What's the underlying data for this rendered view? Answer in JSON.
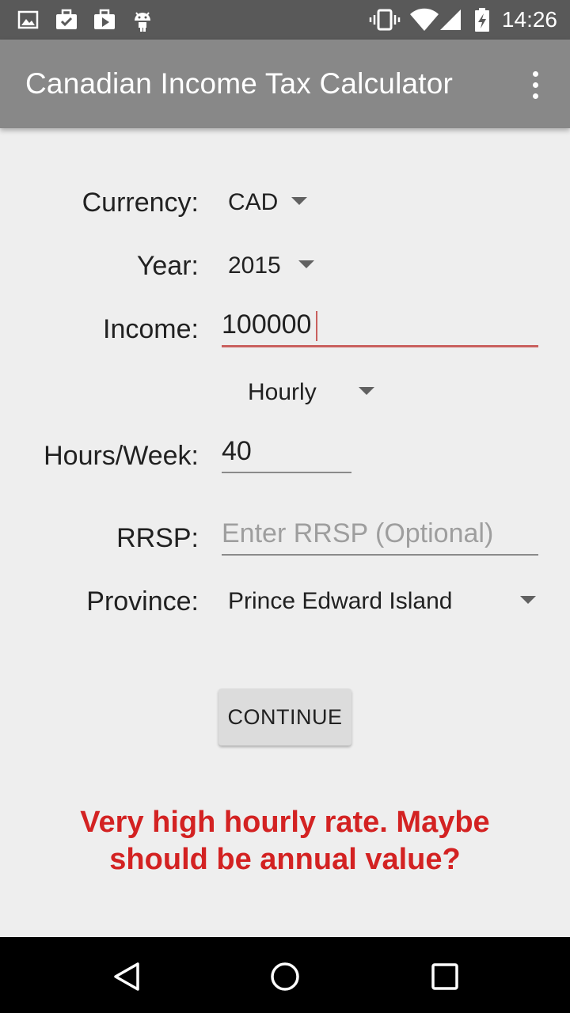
{
  "status_bar": {
    "time": "14:26",
    "icons": [
      "gallery-icon",
      "briefcase-check-icon",
      "play-store-icon",
      "android-icon",
      "vibrate-icon",
      "wifi-icon",
      "signal-icon",
      "battery-charging-icon"
    ]
  },
  "app_bar": {
    "title": "Canadian Income Tax Calculator",
    "menu_icon": "overflow-menu-icon"
  },
  "form": {
    "currency": {
      "label": "Currency:",
      "value": "CAD"
    },
    "year": {
      "label": "Year:",
      "value": "2015"
    },
    "income": {
      "label": "Income:",
      "value": "100000"
    },
    "period": {
      "value": "Hourly"
    },
    "hours": {
      "label": "Hours/Week:",
      "value": "40"
    },
    "rrsp": {
      "label": "RRSP:",
      "value": "",
      "placeholder": "Enter RRSP (Optional)"
    },
    "province": {
      "label": "Province:",
      "value": "Prince Edward Island"
    }
  },
  "actions": {
    "continue_label": "CONTINUE"
  },
  "warning": {
    "text": "Very high hourly rate. Maybe should be annual value?",
    "color": "#d32222"
  },
  "colors": {
    "status_bar": "#595959",
    "app_bar": "#888888",
    "background": "#eeeeee",
    "accent_underline": "#c9605e"
  },
  "nav_bar": {
    "icons": [
      "back-icon",
      "home-icon",
      "recents-icon"
    ]
  }
}
